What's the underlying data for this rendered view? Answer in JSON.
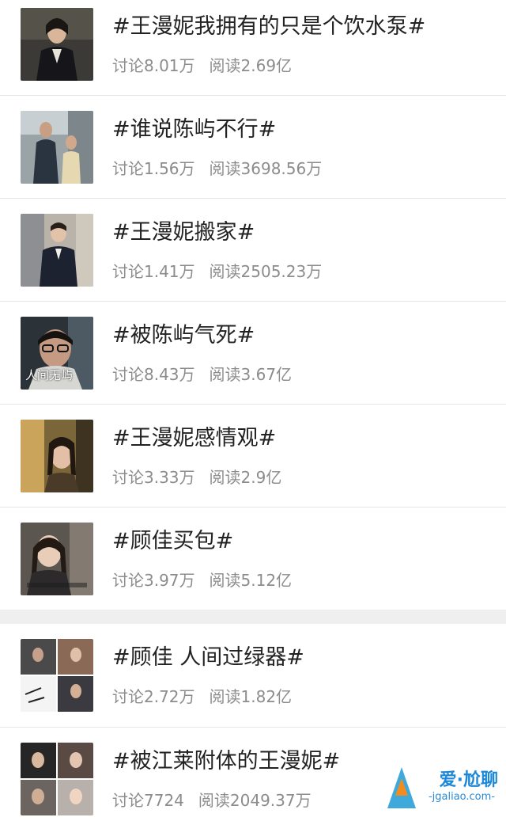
{
  "topics": [
    {
      "title": "#王漫妮我拥有的只是个饮水泵#",
      "discuss": "讨论8.01万",
      "read": "阅读2.69亿"
    },
    {
      "title": "#谁说陈屿不行#",
      "discuss": "讨论1.56万",
      "read": "阅读3698.56万"
    },
    {
      "title": "#王漫妮搬家#",
      "discuss": "讨论1.41万",
      "read": "阅读2505.23万"
    },
    {
      "title": "#被陈屿气死#",
      "discuss": "讨论8.43万",
      "read": "阅读3.67亿",
      "thumb_caption": "人间无屿"
    },
    {
      "title": "#王漫妮感情观#",
      "discuss": "讨论3.33万",
      "read": "阅读2.9亿"
    },
    {
      "title": "#顾佳买包#",
      "discuss": "讨论3.97万",
      "read": "阅读5.12亿"
    },
    {
      "title": "#顾佳 人间过绿器#",
      "discuss": "讨论2.72万",
      "read": "阅读1.82亿"
    },
    {
      "title": "#被江莱附体的王漫妮#",
      "discuss": "讨论7724",
      "read": "阅读2049.37万"
    }
  ],
  "watermark": {
    "text": "爱·尬聊",
    "url": "-jgaliao.com-"
  }
}
